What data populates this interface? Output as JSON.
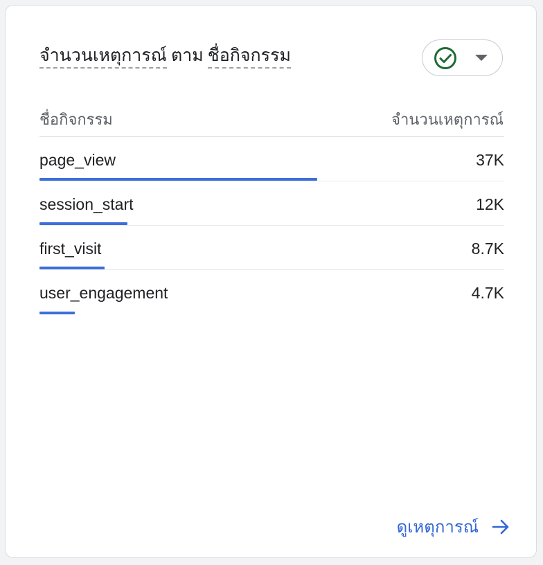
{
  "card": {
    "title_metric": "จำนวนเหตุการณ์",
    "title_joiner": "ตาม",
    "title_dimension": "ชื่อกิจกรรม",
    "compare_icon": "check-circle-icon",
    "dropdown_icon": "caret-down-icon"
  },
  "table": {
    "column_dimension": "ชื่อกิจกรรม",
    "column_metric": "จำนวนเหตุการณ์",
    "rows": [
      {
        "name": "page_view",
        "count": "37K",
        "share": 0.598
      },
      {
        "name": "session_start",
        "count": "12K",
        "share": 0.19
      },
      {
        "name": "first_visit",
        "count": "8.7K",
        "share": 0.14
      },
      {
        "name": "user_engagement",
        "count": "4.7K",
        "share": 0.076
      }
    ],
    "bar_color": "#3d6fd9"
  },
  "footer": {
    "view_link_label": "ดูเหตุการณ์",
    "arrow_icon": "arrow-right-icon",
    "link_color": "#3367d6"
  }
}
